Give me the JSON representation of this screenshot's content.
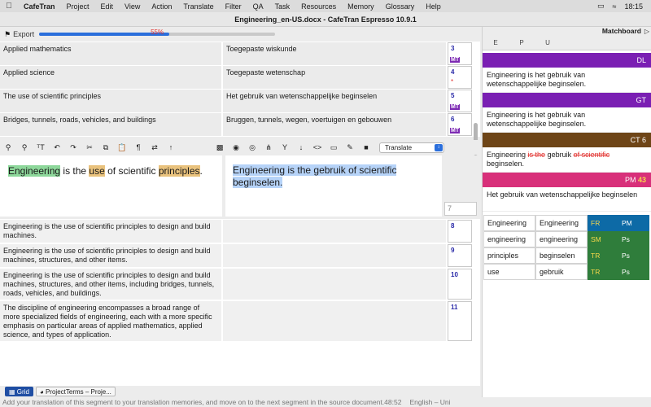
{
  "menubar": {
    "app_name": "CafeTran",
    "menus": [
      "Project",
      "Edit",
      "View",
      "Action",
      "Translate",
      "Filter",
      "QA",
      "Task",
      "Resources",
      "Memory",
      "Glossary",
      "Help"
    ],
    "clock": "18:15"
  },
  "window": {
    "title": "Engineering_en-US.docx - CafeTran Espresso 10.9.1"
  },
  "export": {
    "label": "Export",
    "progress_percent": 55,
    "progress_text": "55%"
  },
  "top_segments": [
    {
      "source": "Applied mathematics",
      "target": "Toegepaste wiskunde",
      "num": "3",
      "badge": "MT"
    },
    {
      "source": "Applied science",
      "target": "Toegepaste wetenschap",
      "num": "4",
      "badge": "*"
    },
    {
      "source": "The use of scientific principles",
      "target": "Het gebruik van wetenschappelijke beginselen",
      "num": "5",
      "badge": "MT"
    },
    {
      "source": "Bridges, tunnels, roads, vehicles, and buildings",
      "target": "Bruggen, tunnels, wegen, voertuigen en gebouwen",
      "num": "6",
      "badge": "MT"
    }
  ],
  "editor": {
    "mode": "Translate",
    "source_parts": [
      "Engineering",
      " is the ",
      "use",
      " of scientific ",
      "principles",
      "."
    ],
    "target": "Engineering is the gebruik of scientific beginselen.",
    "segment_num": "7"
  },
  "bottom_segments": [
    {
      "source": "Engineering is the use of scientific principles to design and build machines.",
      "target": "",
      "num": "8"
    },
    {
      "source": "Engineering is the use of scientific principles to design and build machines, structures, and other items.",
      "target": "",
      "num": "9"
    },
    {
      "source": "Engineering is the use of scientific principles to design and build machines, structures, and other items, including bridges, tunnels, roads, vehicles, and buildings.",
      "target": "",
      "num": "10"
    },
    {
      "source": "The discipline of engineering encompasses a broad range of more specialized fields of engineering, each with a more specific emphasis on particular areas of applied mathematics, applied science, and types of application.",
      "target": "",
      "num": "11"
    }
  ],
  "tabs": {
    "grid": "Grid",
    "project_terms": "ProjectTerms – Proje..."
  },
  "status": {
    "message": "Add your translation of this segment to your translation memories, and move on to the next segment in the source document.",
    "time": "48:52",
    "lang": "English – Uni"
  },
  "matchboard": {
    "title": "Matchboard",
    "tabs": [
      "E",
      "P",
      "U"
    ],
    "dl": {
      "label": "DL",
      "text": "Engineering is het gebruik van wetenschappelijke beginselen.",
      "color": "#7a1fb3"
    },
    "gt": {
      "label": "GT",
      "text": "Engineering is het gebruik van wetenschappelijke beginselen.",
      "color": "#7a1fb3"
    },
    "ct": {
      "label": "CT 6",
      "text_a": "Engineering ",
      "strike_a": "is the",
      "text_b": " gebruik ",
      "strike_b": "of scientific",
      "text_c": " beginselen.",
      "color": "#6e4517"
    },
    "pm": {
      "label": "PM",
      "num": "43",
      "text": "Het gebruik van wetenschappelijke beginselen",
      "color": "#d8307a"
    },
    "terms": [
      {
        "src": "Engineering",
        "tgt": "Engineering",
        "code": "FR",
        "type": "PM",
        "code_color": "#0d6aa6",
        "type_color": "#0d6aa6"
      },
      {
        "src": "engineering",
        "tgt": "engineering",
        "code": "SM",
        "type": "Ps",
        "code_color": "#2f7d3b",
        "type_color": "#2f7d3b"
      },
      {
        "src": "principles",
        "tgt": "beginselen",
        "code": "TR",
        "type": "Ps",
        "code_color": "#2f7d3b",
        "type_color": "#2f7d3b"
      },
      {
        "src": "use",
        "tgt": "gebruik",
        "code": "TR",
        "type": "Ps",
        "code_color": "#2f7d3b",
        "type_color": "#2f7d3b"
      }
    ]
  }
}
